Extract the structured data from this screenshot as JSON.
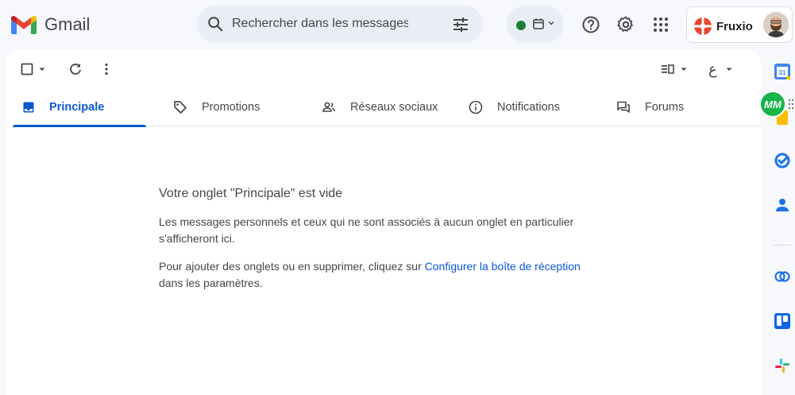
{
  "app": {
    "name": "Gmail"
  },
  "search": {
    "placeholder": "Rechercher dans les messages"
  },
  "account": {
    "brand": "Fruxio"
  },
  "toolbar": {
    "lang_label": "ع"
  },
  "tabs": [
    {
      "label": "Principale",
      "icon": "inbox-icon",
      "active": true
    },
    {
      "label": "Promotions",
      "icon": "tag-icon",
      "active": false
    },
    {
      "label": "Réseaux sociaux",
      "icon": "people-icon",
      "active": false
    },
    {
      "label": "Notifications",
      "icon": "info-icon",
      "active": false
    },
    {
      "label": "Forums",
      "icon": "forum-icon",
      "active": false
    }
  ],
  "empty_state": {
    "title": "Votre onglet \"Principale\" est vide",
    "line1": "Les messages personnels et ceux qui ne sont associés à aucun onglet en particulier s'afficheront ici.",
    "line2_prefix": "Pour ajouter des onglets ou en supprimer, cliquez sur ",
    "line2_link": "Configurer la boîte de réception",
    "line2_suffix": "dans les paramètres."
  },
  "side_panel": {
    "calendar_label": "31",
    "extension_label": "MM"
  },
  "colors": {
    "accent": "#0b57d0",
    "status_online": "#188038",
    "extension": "#18b44a"
  }
}
